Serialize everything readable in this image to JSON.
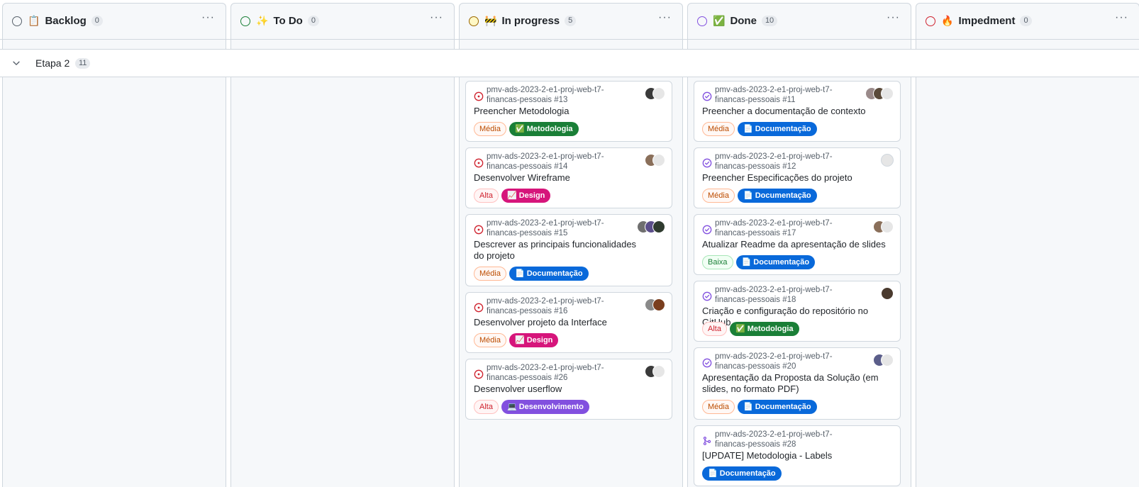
{
  "columns": [
    {
      "title": "Backlog",
      "count": "0",
      "emoji": "📋",
      "circle": "#57606a"
    },
    {
      "title": "To Do",
      "count": "0",
      "emoji": "✨",
      "circle": "#1a7f37"
    },
    {
      "title": "In progress",
      "count": "5",
      "emoji": "🚧",
      "circle": "#9a6700"
    },
    {
      "title": "Done",
      "count": "10",
      "emoji": "✅",
      "circle": "#8250df"
    },
    {
      "title": "Impedment",
      "count": "0",
      "emoji": "🔥",
      "circle": "#cf222e"
    }
  ],
  "menu_dots": "···",
  "group": {
    "title": "Etapa 2",
    "count": "11"
  },
  "colors": {
    "open_issue": "#cf222e",
    "closed_issue": "#8250df",
    "metodologia": "#1a7f37",
    "design": "#d6157b",
    "documentacao": "#0969da",
    "desenvolvimento": "#8250df"
  },
  "in_progress_cards": [
    {
      "repo": "pmv-ads-2023-2-e1-proj-web-t7-financas-pessoais #13",
      "title": "Preencher Metodologia",
      "priority": "Média",
      "tag": "✅ Metodologia"
    },
    {
      "repo": "pmv-ads-2023-2-e1-proj-web-t7-financas-pessoais #14",
      "title": "Desenvolver Wireframe",
      "priority": "Alta",
      "tag": "📈 Design"
    },
    {
      "repo": "pmv-ads-2023-2-e1-proj-web-t7-financas-pessoais #15",
      "title": "Descrever as principais funcionalidades do projeto",
      "priority": "Média",
      "tag": "📄 Documentação"
    },
    {
      "repo": "pmv-ads-2023-2-e1-proj-web-t7-financas-pessoais #16",
      "title": "Desenvolver projeto da Interface",
      "priority": "Média",
      "tag": "📈 Design"
    },
    {
      "repo": "pmv-ads-2023-2-e1-proj-web-t7-financas-pessoais #26",
      "title": "Desenvolver userflow",
      "priority": "Alta",
      "tag": "💻 Desenvolvimento"
    }
  ],
  "done_cards": [
    {
      "repo": "pmv-ads-2023-2-e1-proj-web-t7-financas-pessoais #11",
      "title": "Preencher a documentação de contexto",
      "priority": "Média",
      "tag": "📄 Documentação"
    },
    {
      "repo": "pmv-ads-2023-2-e1-proj-web-t7-financas-pessoais #12",
      "title": "Preencher Especificações do projeto",
      "priority": "Média",
      "tag": "📄 Documentação"
    },
    {
      "repo": "pmv-ads-2023-2-e1-proj-web-t7-financas-pessoais #17",
      "title": "Atualizar Readme da apresentação de slides",
      "priority": "Baixa",
      "tag": "📄 Documentação"
    },
    {
      "repo": "pmv-ads-2023-2-e1-proj-web-t7-financas-pessoais #18",
      "title": "Criação e configuração do repositório no GitHub",
      "priority": "Alta",
      "tag": "✅ Metodologia"
    },
    {
      "repo": "pmv-ads-2023-2-e1-proj-web-t7-financas-pessoais #20",
      "title": "Apresentação da Proposta da Solução (em slides, no formato PDF)",
      "priority": "Média",
      "tag": "📄 Documentação"
    },
    {
      "repo": "pmv-ads-2023-2-e1-proj-web-t7-financas-pessoais #28",
      "title": "[UPDATE] Metodologia - Labels",
      "tag": "📄 Documentação"
    }
  ]
}
